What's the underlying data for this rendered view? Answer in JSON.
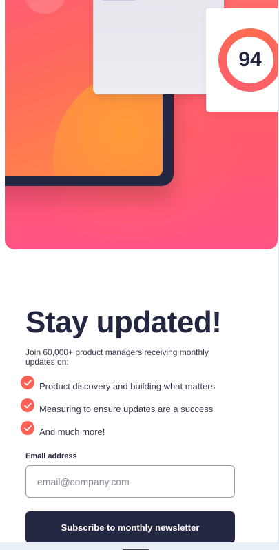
{
  "hero": {
    "score": "94",
    "icons": {
      "illustration": "dashboard-illustration",
      "check": "check-icon"
    }
  },
  "signup": {
    "title": "Stay updated!",
    "lead": "Join 60,000+ product managers receiving monthly updates on:",
    "features": [
      "Product discovery and building what matters",
      "Measuring to ensure updates are a success",
      "And much more!"
    ],
    "email_label": "Email address",
    "email_placeholder": "email@company.com",
    "email_value": "",
    "submit_label": "Subscribe to monthly newsletter"
  },
  "colors": {
    "accent": "#ff6155",
    "dark": "#242742",
    "text": "#36384e",
    "gradient_start": "#ff6a6a",
    "gradient_end": "#ff8a45"
  }
}
